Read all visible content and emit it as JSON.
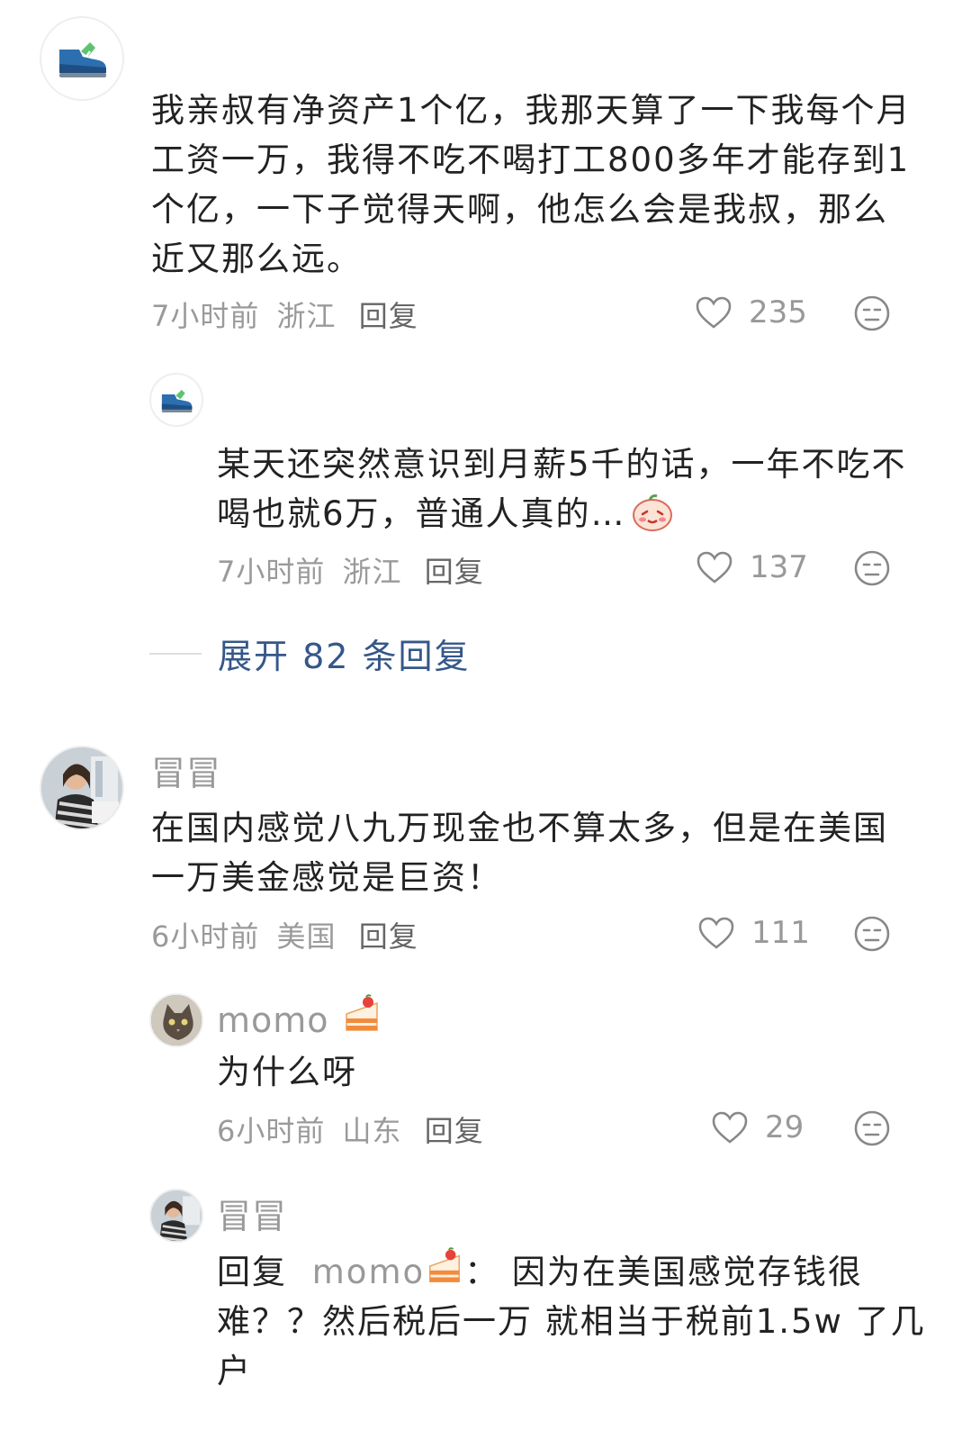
{
  "comments": [
    {
      "avatar_icon": "sneaker-icon",
      "text": "我亲叔有净资产1个亿，我那天算了一下我每个月工资一万，我得不吃不喝打工800多年才能存到1个亿，一下子觉得天啊，他怎么会是我叔，那么近又那么远。",
      "time": "7小时前",
      "location": "浙江",
      "reply_label": "回复",
      "likes": "235",
      "replies": [
        {
          "avatar_icon": "sneaker-icon",
          "text": "某天还突然意识到月薪5千的话，一年不吃不喝也就6万，普通人真的…",
          "emoji": "blushing-face-icon",
          "time": "7小时前",
          "location": "浙江",
          "reply_label": "回复",
          "likes": "137"
        }
      ],
      "expand_label": "展开 82 条回复"
    },
    {
      "username": "冒冒",
      "text": "在国内感觉八九万现金也不算太多，但是在美国一万美金感觉是巨资！",
      "time": "6小时前",
      "location": "美国",
      "reply_label": "回复",
      "likes": "111",
      "replies": [
        {
          "username": "momo",
          "username_emoji": "cake-icon",
          "text": "为什么呀",
          "time": "6小时前",
          "location": "山东",
          "reply_label": "回复",
          "likes": "29"
        },
        {
          "username": "冒冒",
          "reply_prefix": "回复",
          "reply_to": "momo",
          "reply_to_emoji": "cake-icon",
          "text": "：  因为在美国感觉存钱很难？？然后税后一万 就相当于税前1.5w 了几户"
        }
      ]
    }
  ],
  "colors": {
    "text": "#222222",
    "meta": "#9a9a9a",
    "link": "#35578a",
    "like_icon": "#888888"
  }
}
